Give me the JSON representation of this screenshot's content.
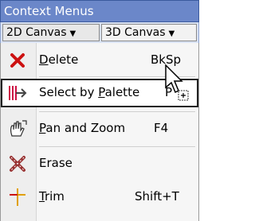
{
  "title": "Context Menus",
  "tabs": [
    {
      "label": "2D Canvas",
      "arrow": "▼"
    },
    {
      "label": "3D Canvas",
      "arrow": "▼"
    }
  ],
  "menu_items": [
    {
      "pre": "",
      "u": "D",
      "post": "elete",
      "shortcut": "BkSp",
      "icon": "delete-icon"
    },
    {
      "pre": "Select by ",
      "u": "P",
      "post": "alette",
      "shortcut": "P",
      "icon": "select-palette-icon"
    },
    {
      "pre": "",
      "u": "P",
      "post": "an and Zoom",
      "shortcut": "F4",
      "icon": "pan-zoom-icon"
    },
    {
      "pre": "",
      "u": "",
      "post": "Erase",
      "shortcut": "",
      "icon": "erase-icon"
    },
    {
      "pre": "",
      "u": "T",
      "post": "rim",
      "shortcut": "Shift+T",
      "icon": "trim-icon"
    }
  ],
  "colors": {
    "accent": "#6b87c9",
    "delete_red": "#cc1111"
  }
}
